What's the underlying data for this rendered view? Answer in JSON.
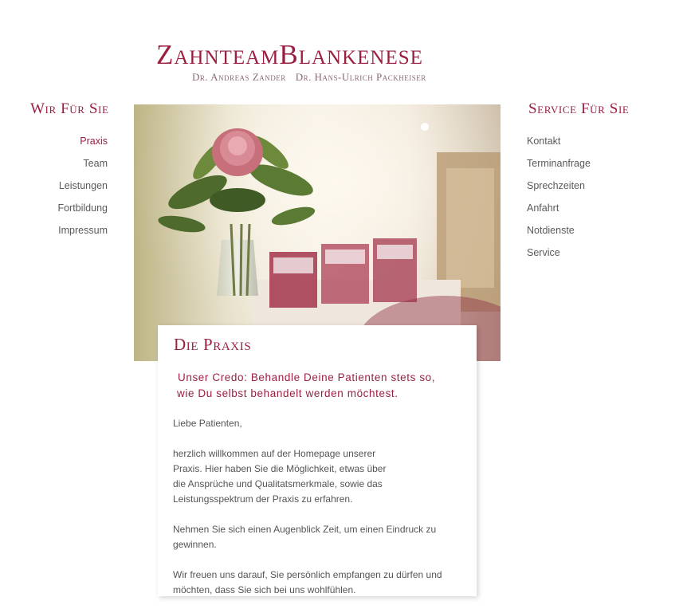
{
  "logo": {
    "title": "ZahnteamBlankenese",
    "doctor1": "Dr. Andreas Zander",
    "doctor2": "Dr. Hans-Ulrich Packheiser"
  },
  "left_nav": {
    "heading": "Wir Für Sie",
    "items": [
      {
        "label": "Praxis",
        "active": true
      },
      {
        "label": "Team"
      },
      {
        "label": "Leistungen"
      },
      {
        "label": "Fortbildung"
      },
      {
        "label": "Impressum"
      }
    ]
  },
  "right_nav": {
    "heading": "Service Für Sie",
    "items": [
      {
        "label": "Kontakt"
      },
      {
        "label": "Terminanfrage"
      },
      {
        "label": "Sprechzeiten"
      },
      {
        "label": "Anfahrt"
      },
      {
        "label": "Notdienste"
      },
      {
        "label": "Service"
      }
    ]
  },
  "content": {
    "title": "Die Praxis",
    "credo_line1": "Unser Credo: Behandle Deine Patienten stets so,",
    "credo_line2": "wie Du selbst behandelt werden möchtest.",
    "greeting": "Liebe Patienten,",
    "para1": [
      "herzlich willkommen auf der Homepage unserer",
      "Praxis. Hier haben Sie die Möglichkeit, etwas über",
      "die Ansprüche und Qualitatsmerkmale, sowie das",
      "Leistungsspektrum der Praxis zu erfahren."
    ],
    "para2": [
      "Nehmen Sie sich einen Augenblick Zeit, um einen Eindruck zu",
      "gewinnen."
    ],
    "para3": [
      "Wir freuen uns darauf, Sie persönlich empfangen zu dürfen und",
      "möchten, dass Sie sich bei uns wohlfühlen."
    ]
  },
  "colors": {
    "accent": "#9b2040",
    "text": "#555555",
    "background": "#ffffff"
  }
}
